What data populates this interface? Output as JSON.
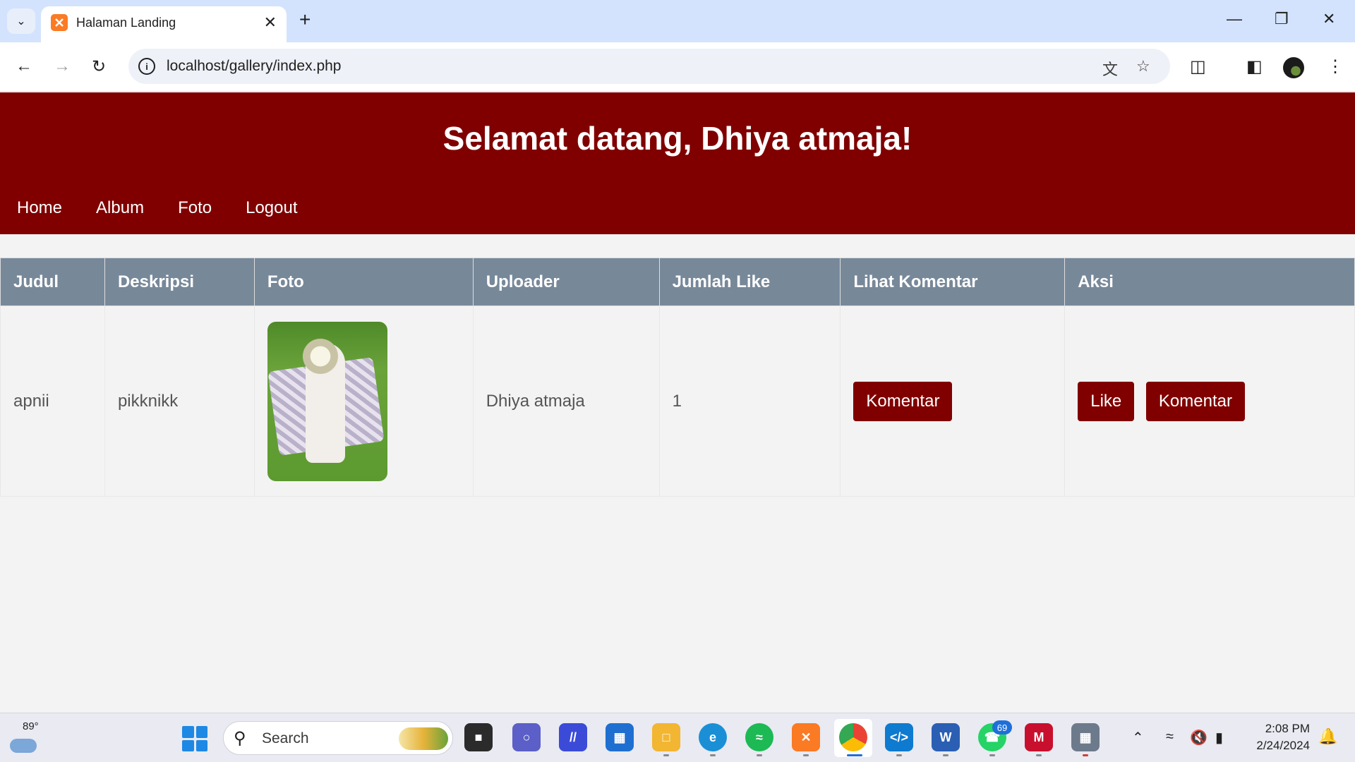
{
  "browser": {
    "tab_title": "Halaman Landing",
    "url": "localhost/gallery/index.php",
    "icons": {
      "tab_search": "chevron-down-icon",
      "close_tab": "close-icon",
      "new_tab": "plus-icon",
      "back": "arrow-left-icon",
      "forward": "arrow-right-icon",
      "reload": "reload-icon",
      "site_info": "info-icon",
      "translate": "translate-icon",
      "bookmark": "star-icon",
      "extensions": "puzzle-icon",
      "side_panel": "side-panel-icon",
      "menu": "kebab-menu-icon"
    }
  },
  "header": {
    "title": "Selamat datang, Dhiya atmaja!",
    "background": "#800000"
  },
  "nav": {
    "items": [
      "Home",
      "Album",
      "Foto",
      "Logout"
    ]
  },
  "table": {
    "header_color": "#778899",
    "columns": [
      "Judul",
      "Deskripsi",
      "Foto",
      "Uploader",
      "Jumlah Like",
      "Lihat Komentar",
      "Aksi"
    ],
    "rows": [
      {
        "judul": "apnii",
        "deskripsi": "pikknikk",
        "uploader": "Dhiya atmaja",
        "jumlah_like": "1",
        "lihat_komentar_button": "Komentar",
        "like_button": "Like",
        "komentar_button": "Komentar"
      }
    ]
  },
  "taskbar": {
    "weather_temp": "89°",
    "search_placeholder": "Search",
    "whatsapp_badge": "69",
    "time": "2:08 PM",
    "date": "2/24/2024",
    "apps": [
      "file-explorer-icon",
      "zoom-icon",
      "app-icon",
      "microsoft-store-icon",
      "folder-icon",
      "edge-icon",
      "spotify-icon",
      "xampp-icon",
      "chrome-icon",
      "vscode-icon",
      "word-icon",
      "whatsapp-icon",
      "mcafee-icon",
      "calculator-icon"
    ]
  }
}
